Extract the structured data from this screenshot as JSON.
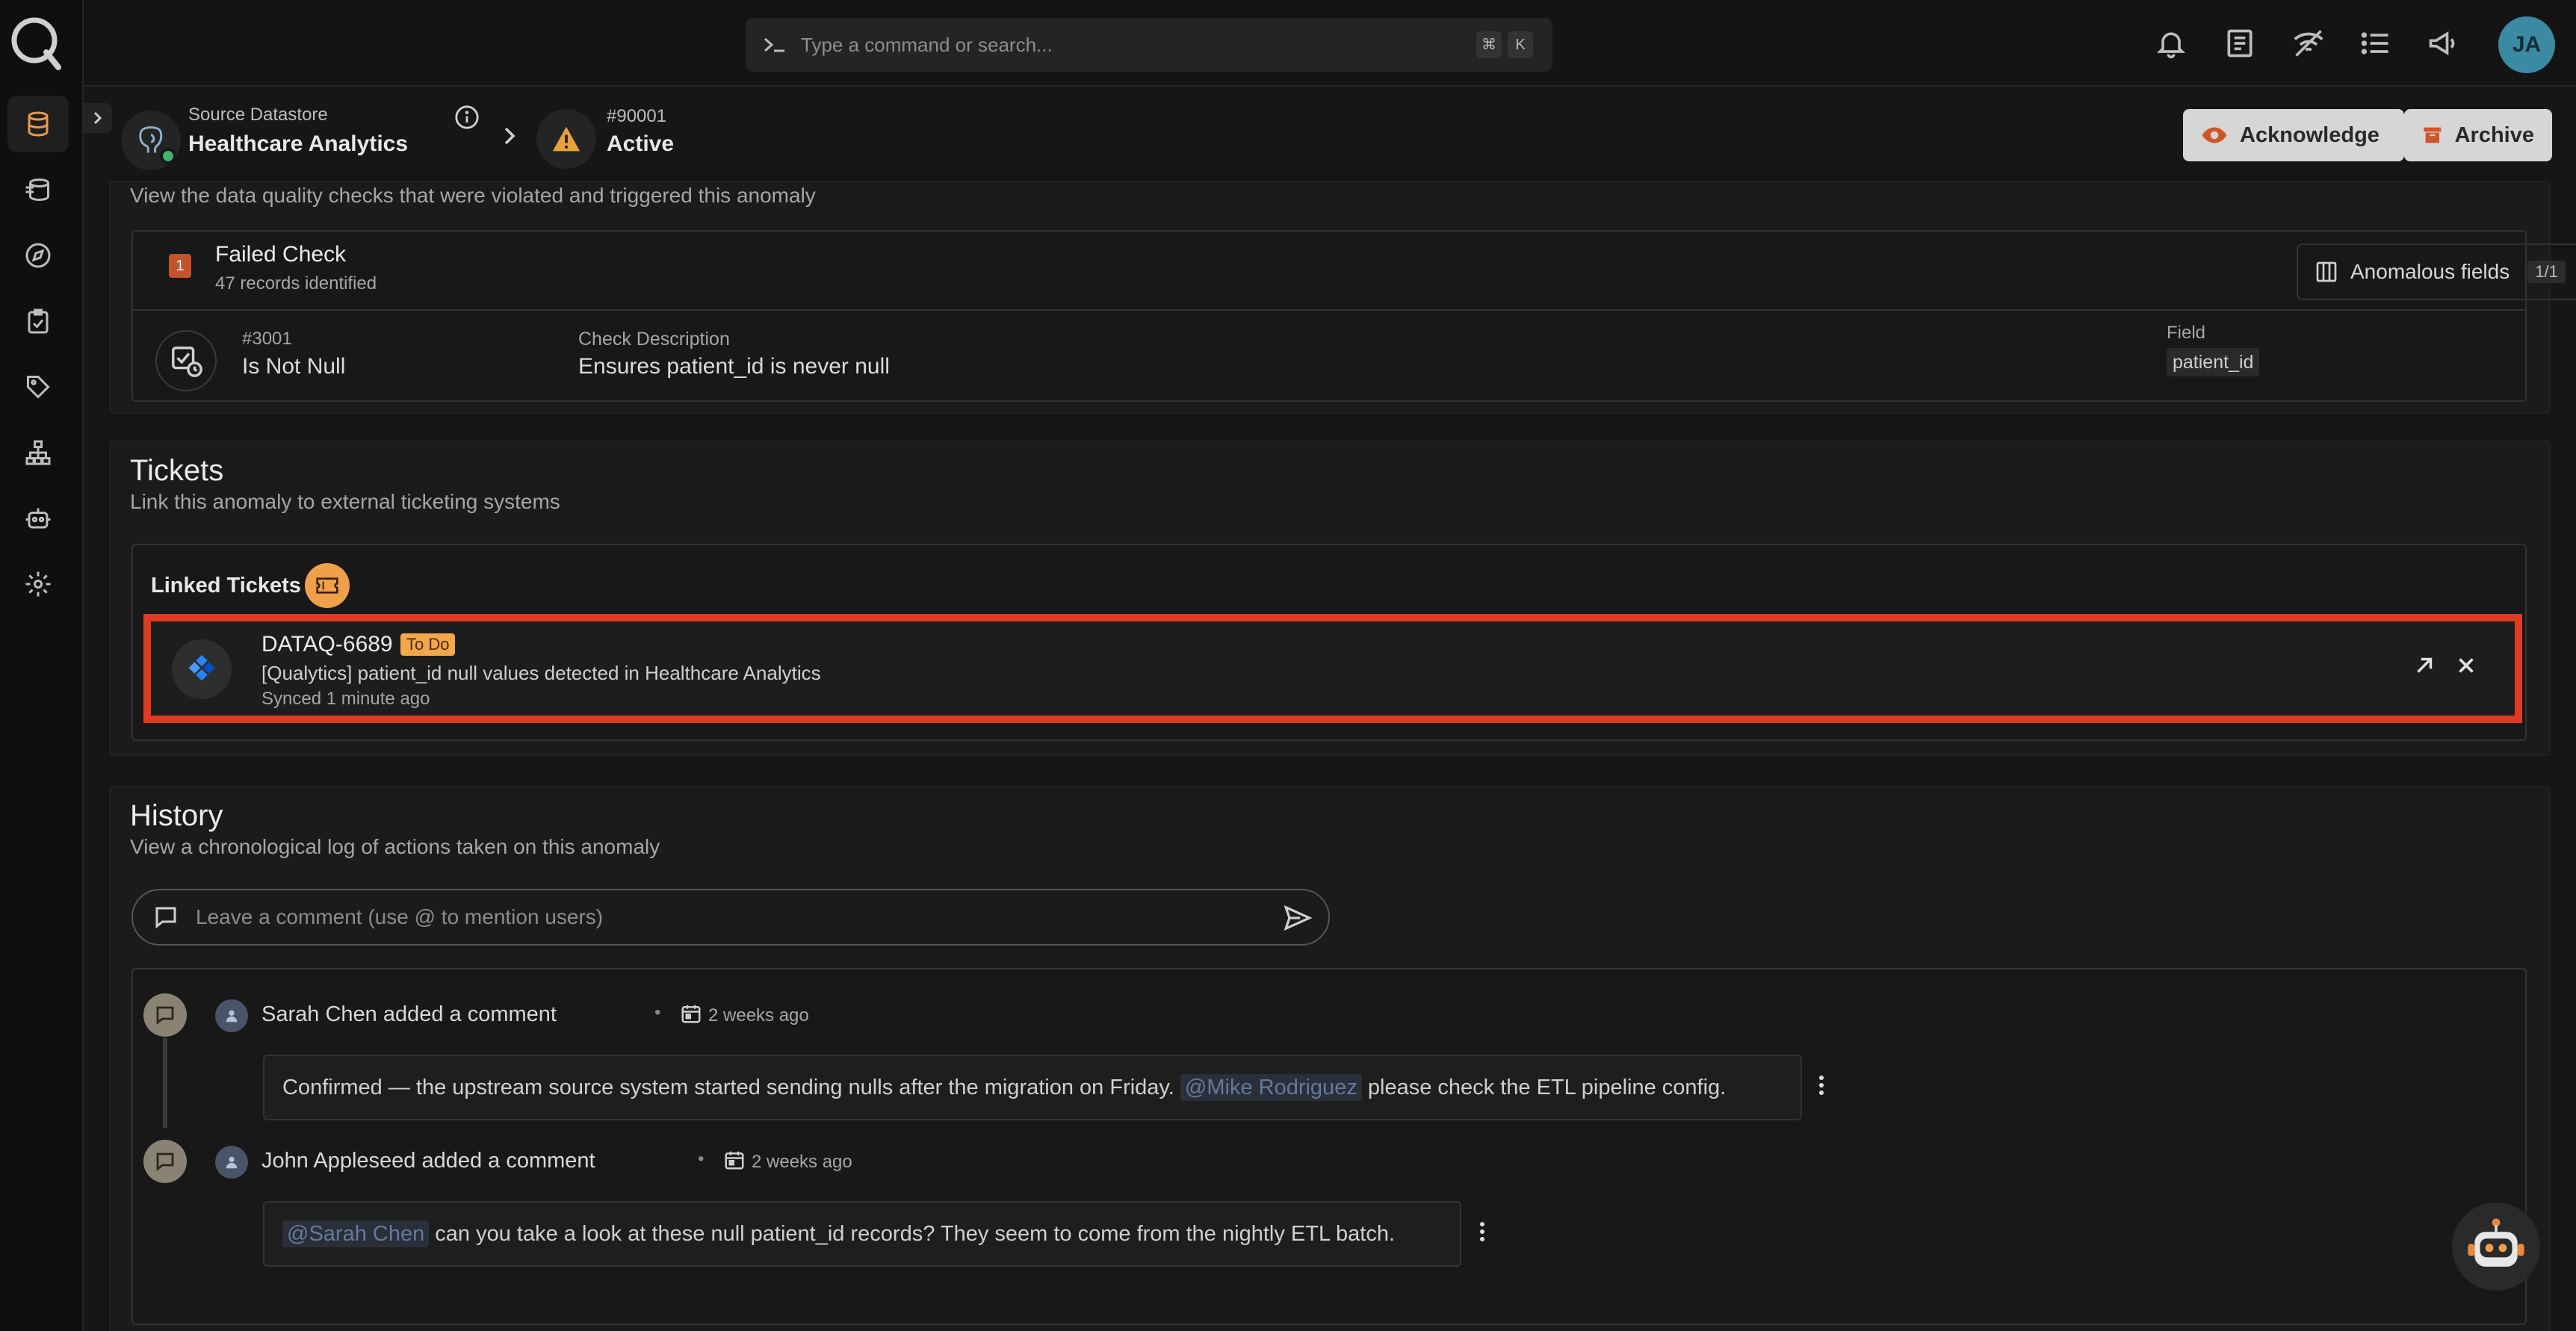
{
  "search": {
    "placeholder": "Type a command or search...",
    "kbd_cmd": "⌘",
    "kbd_k": "K"
  },
  "user": {
    "initials": "JA"
  },
  "header": {
    "datastore_label": "Source Datastore",
    "datastore_name": "Healthcare Analytics",
    "anomaly_id": "#90001",
    "anomaly_status": "Active",
    "acknowledge_label": "Acknowledge",
    "archive_label": "Archive"
  },
  "checks": {
    "intro": "View the data quality checks that were violated and triggered this anomaly",
    "failed_count": "1",
    "failed_title": "Failed Check",
    "failed_sub": "47 records identified",
    "anomalous_fields_label": "Anomalous fields",
    "anomalous_fields_count": "1/1",
    "check_id": "#3001",
    "check_type": "Is Not Null",
    "desc_label": "Check Description",
    "desc_value": "Ensures patient_id is never null",
    "field_label": "Field",
    "field_value": "patient_id"
  },
  "tickets": {
    "title": "Tickets",
    "subtitle": "Link this anomaly to external ticketing systems",
    "linked_label": "Linked Tickets",
    "ticket": {
      "key": "DATAQ-6689",
      "status": "To Do",
      "summary": "[Qualytics] patient_id null values detected in Healthcare Analytics",
      "synced": "Synced 1 minute ago"
    }
  },
  "history": {
    "title": "History",
    "subtitle": "View a chronological log of actions taken on this anomaly",
    "comment_placeholder": "Leave a comment (use @ to mention users)",
    "entries": [
      {
        "author_action": "Sarah Chen added a comment",
        "time": "2 weeks ago",
        "text_before": "Confirmed — the upstream source system started sending nulls after the migration on Friday.",
        "mention": "@Mike Rodriguez",
        "text_after": "please check the ETL pipeline config."
      },
      {
        "author_action": "John Appleseed added a comment",
        "time": "2 weeks ago",
        "mention": "@Sarah Chen",
        "text_after": "can you take a look at these null patient_id records? They seem to come from the nightly ETL batch."
      }
    ]
  },
  "colors": {
    "accent": "#f3a64a",
    "highlight_border": "#e03a23",
    "archive_icon": "#d2552a"
  }
}
